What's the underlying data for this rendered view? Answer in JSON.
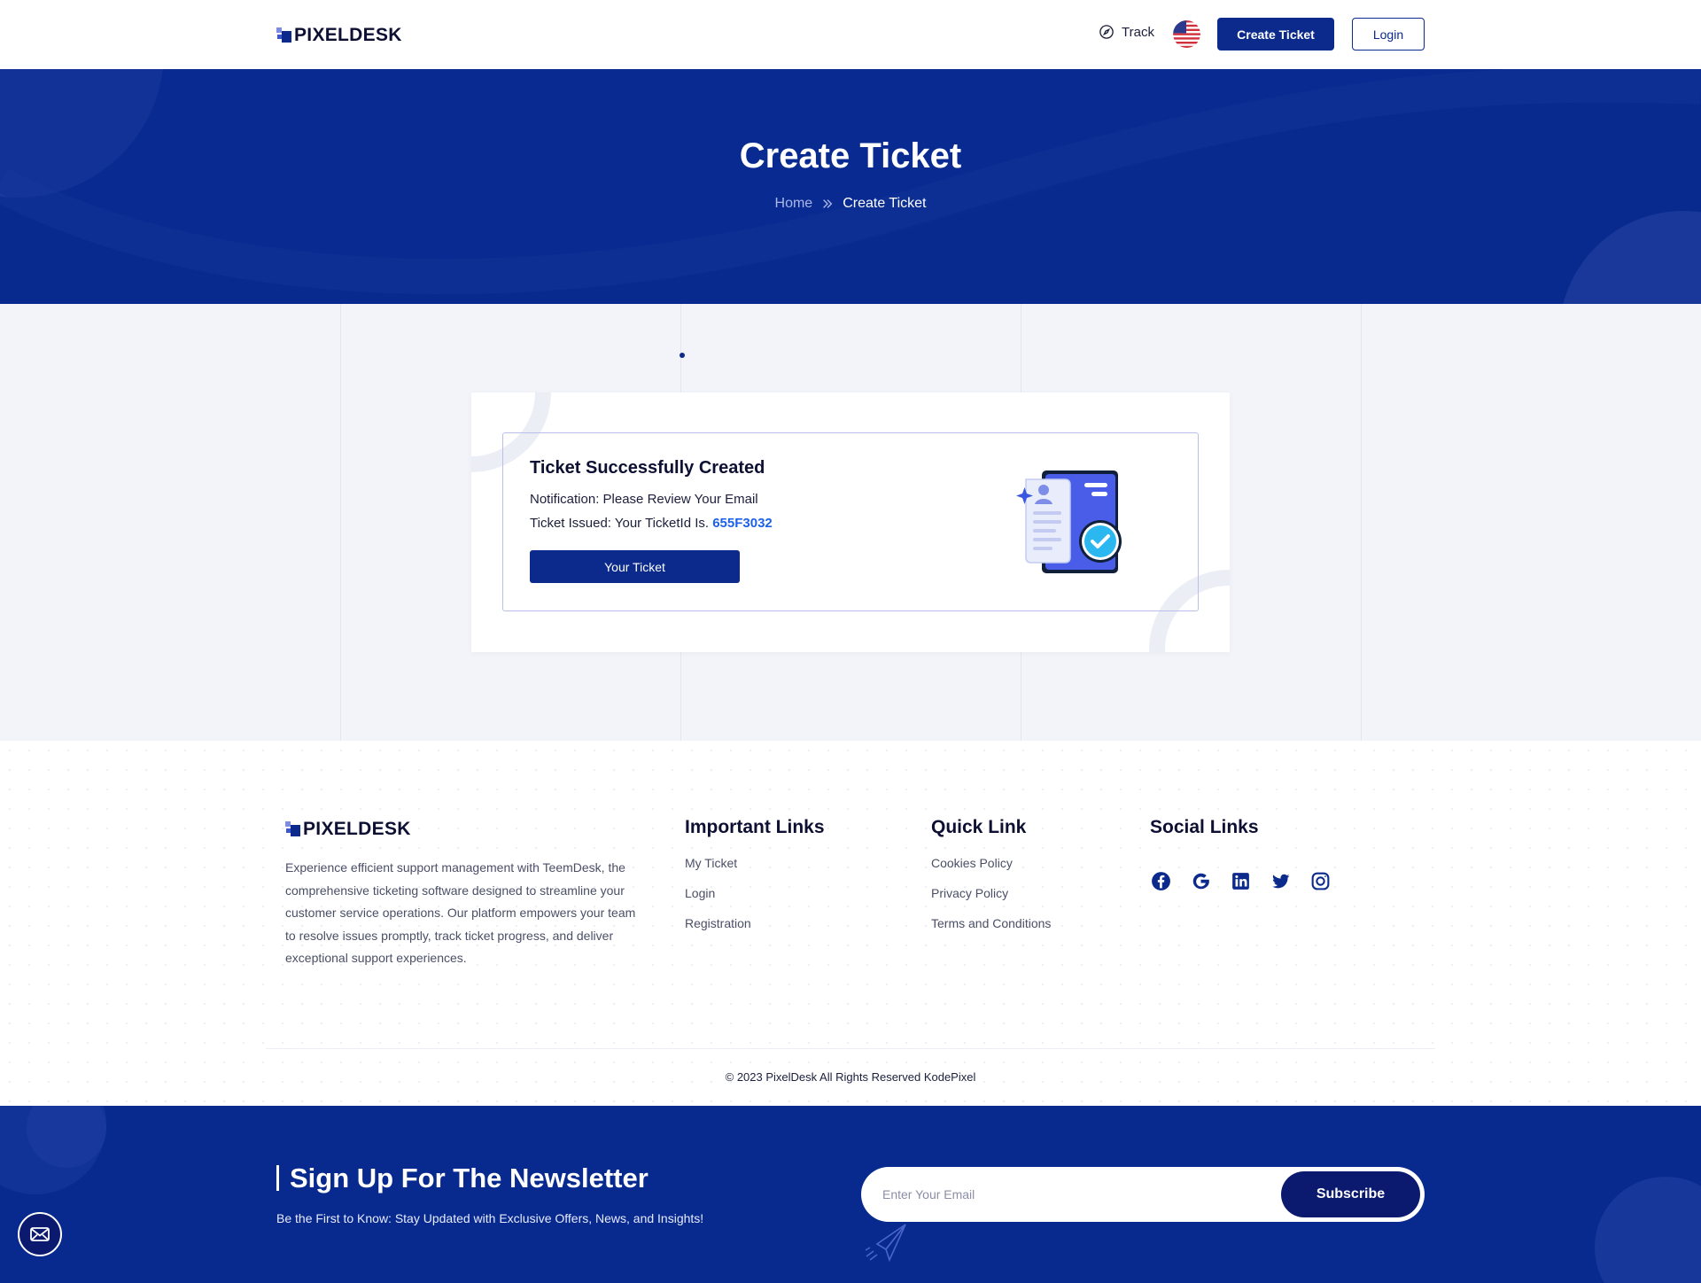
{
  "brand": {
    "name": "PIXELDESK"
  },
  "header": {
    "track_label": "Track",
    "create_ticket_label": "Create Ticket",
    "login_label": "Login",
    "language_flag": "us-flag"
  },
  "hero": {
    "title": "Create Ticket",
    "breadcrumb": {
      "home": "Home",
      "current": "Create Ticket"
    }
  },
  "ticket": {
    "title": "Ticket Successfully Created",
    "notification": "Notification: Please Review Your Email",
    "issued_prefix": "Ticket Issued: Your TicketId Is.",
    "ticket_id": "655F3032",
    "button_label": "Your Ticket"
  },
  "footer": {
    "description": "Experience efficient support management with TeemDesk, the comprehensive ticketing software designed to streamline your customer service operations. Our platform empowers your team to resolve issues promptly, track ticket progress, and deliver exceptional support experiences.",
    "important_links": {
      "title": "Important Links",
      "items": [
        "My Ticket",
        "Login",
        "Registration"
      ]
    },
    "quick_link": {
      "title": "Quick Link",
      "items": [
        "Cookies Policy",
        "Privacy Policy",
        "Terms and Conditions"
      ]
    },
    "social_links": {
      "title": "Social Links",
      "icons": [
        "facebook-icon",
        "google-icon",
        "linkedin-icon",
        "twitter-icon",
        "instagram-icon"
      ]
    },
    "copyright": "© 2023 PixelDesk All Rights Reserved KodePixel"
  },
  "newsletter": {
    "title": "Sign Up For The Newsletter",
    "subtitle": "Be the First to Know: Stay Updated with Exclusive Offers, News, and Insights!",
    "email_placeholder": "Enter Your Email",
    "subscribe_label": "Subscribe"
  },
  "colors": {
    "primary": "#0b2a8c",
    "hero_bg": "#082a8f",
    "accent_link": "#1d62e6",
    "page_bg": "#f2f4f9"
  }
}
